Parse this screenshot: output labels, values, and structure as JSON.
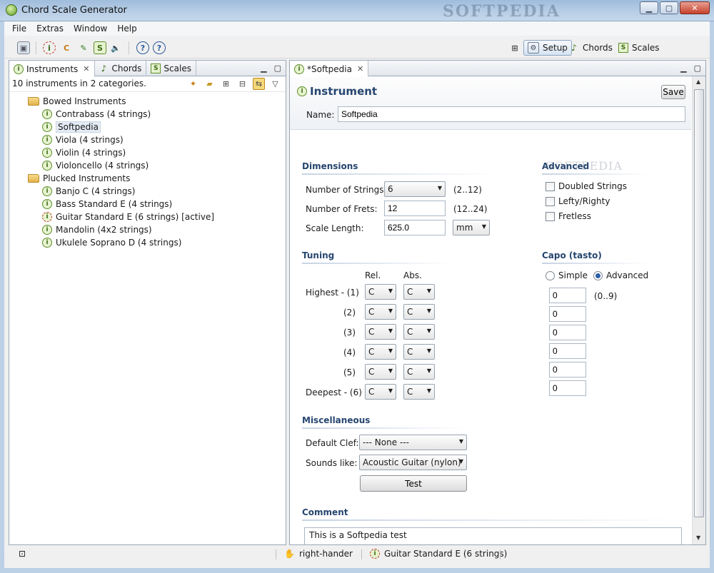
{
  "window": {
    "title": "Chord Scale Generator",
    "watermark": "SOFTPEDIA",
    "buttons": {
      "minimize": "▁",
      "maximize": "▢",
      "close": "✕"
    }
  },
  "menu": [
    "File",
    "Extras",
    "Window",
    "Help"
  ],
  "perspectives": [
    {
      "label": "Setup",
      "active": true
    },
    {
      "label": "Chords",
      "active": false
    },
    {
      "label": "Scales",
      "active": false
    }
  ],
  "instruments_view": {
    "tabs": [
      {
        "label": "Instruments",
        "active": true
      },
      {
        "label": "Chords",
        "active": false
      },
      {
        "label": "Scales",
        "active": false
      }
    ],
    "summary": "10 instruments in 2 categories.",
    "categories": [
      {
        "name": "Bowed Instruments",
        "items": [
          {
            "label": "Contrabass (4 strings)"
          },
          {
            "label": "Softpedia",
            "selected": true
          },
          {
            "label": "Viola (4 strings)"
          },
          {
            "label": "Violin (4 strings)"
          },
          {
            "label": "Violoncello (4 strings)"
          }
        ]
      },
      {
        "name": "Plucked Instruments",
        "items": [
          {
            "label": "Banjo C (4 strings)"
          },
          {
            "label": "Bass Standard E (4 strings)"
          },
          {
            "label": "Guitar Standard E (6 strings) [active]",
            "active": true
          },
          {
            "label": "Mandolin (4x2 strings)"
          },
          {
            "label": "Ukulele Soprano D (4 strings)"
          }
        ]
      }
    ]
  },
  "editor": {
    "tab_label": "*Softpedia",
    "title": "Instrument",
    "save_label": "Save",
    "name_label": "Name:",
    "name_value": "Softpedia",
    "dimensions": {
      "heading": "Dimensions",
      "strings_label": "Number of Strings:",
      "strings_value": "6",
      "strings_range": "(2..12)",
      "frets_label": "Number of Frets:",
      "frets_value": "12",
      "frets_range": "(12..24)",
      "scale_label": "Scale Length:",
      "scale_value": "625.0",
      "scale_unit": "mm"
    },
    "advanced": {
      "heading": "Advanced",
      "options": [
        "Doubled Strings",
        "Lefty/Righty",
        "Fretless"
      ]
    },
    "tuning": {
      "heading": "Tuning",
      "col_rel": "Rel.",
      "col_abs": "Abs.",
      "rows": [
        {
          "label": "Highest - (1)",
          "rel": "C",
          "abs": "C"
        },
        {
          "label": "(2)",
          "rel": "C",
          "abs": "C"
        },
        {
          "label": "(3)",
          "rel": "C",
          "abs": "C"
        },
        {
          "label": "(4)",
          "rel": "C",
          "abs": "C"
        },
        {
          "label": "(5)",
          "rel": "C",
          "abs": "C"
        },
        {
          "label": "Deepest - (6)",
          "rel": "C",
          "abs": "C"
        }
      ]
    },
    "capo": {
      "heading": "Capo (tasto)",
      "mode_simple": "Simple",
      "mode_advanced": "Advanced",
      "selected_mode": "Advanced",
      "values": [
        "0",
        "0",
        "0",
        "0",
        "0",
        "0"
      ],
      "range": "(0..9)"
    },
    "misc": {
      "heading": "Miscellaneous",
      "clef_label": "Default Clef:",
      "clef_value": "--- None ---",
      "sounds_label": "Sounds like:",
      "sounds_value": "Acoustic Guitar (nylon)",
      "test_label": "Test"
    },
    "comment": {
      "heading": "Comment",
      "text": "This is a Softpedia test"
    }
  },
  "status": {
    "hand": "right-hander",
    "instrument": "Guitar Standard E (6 strings)"
  }
}
